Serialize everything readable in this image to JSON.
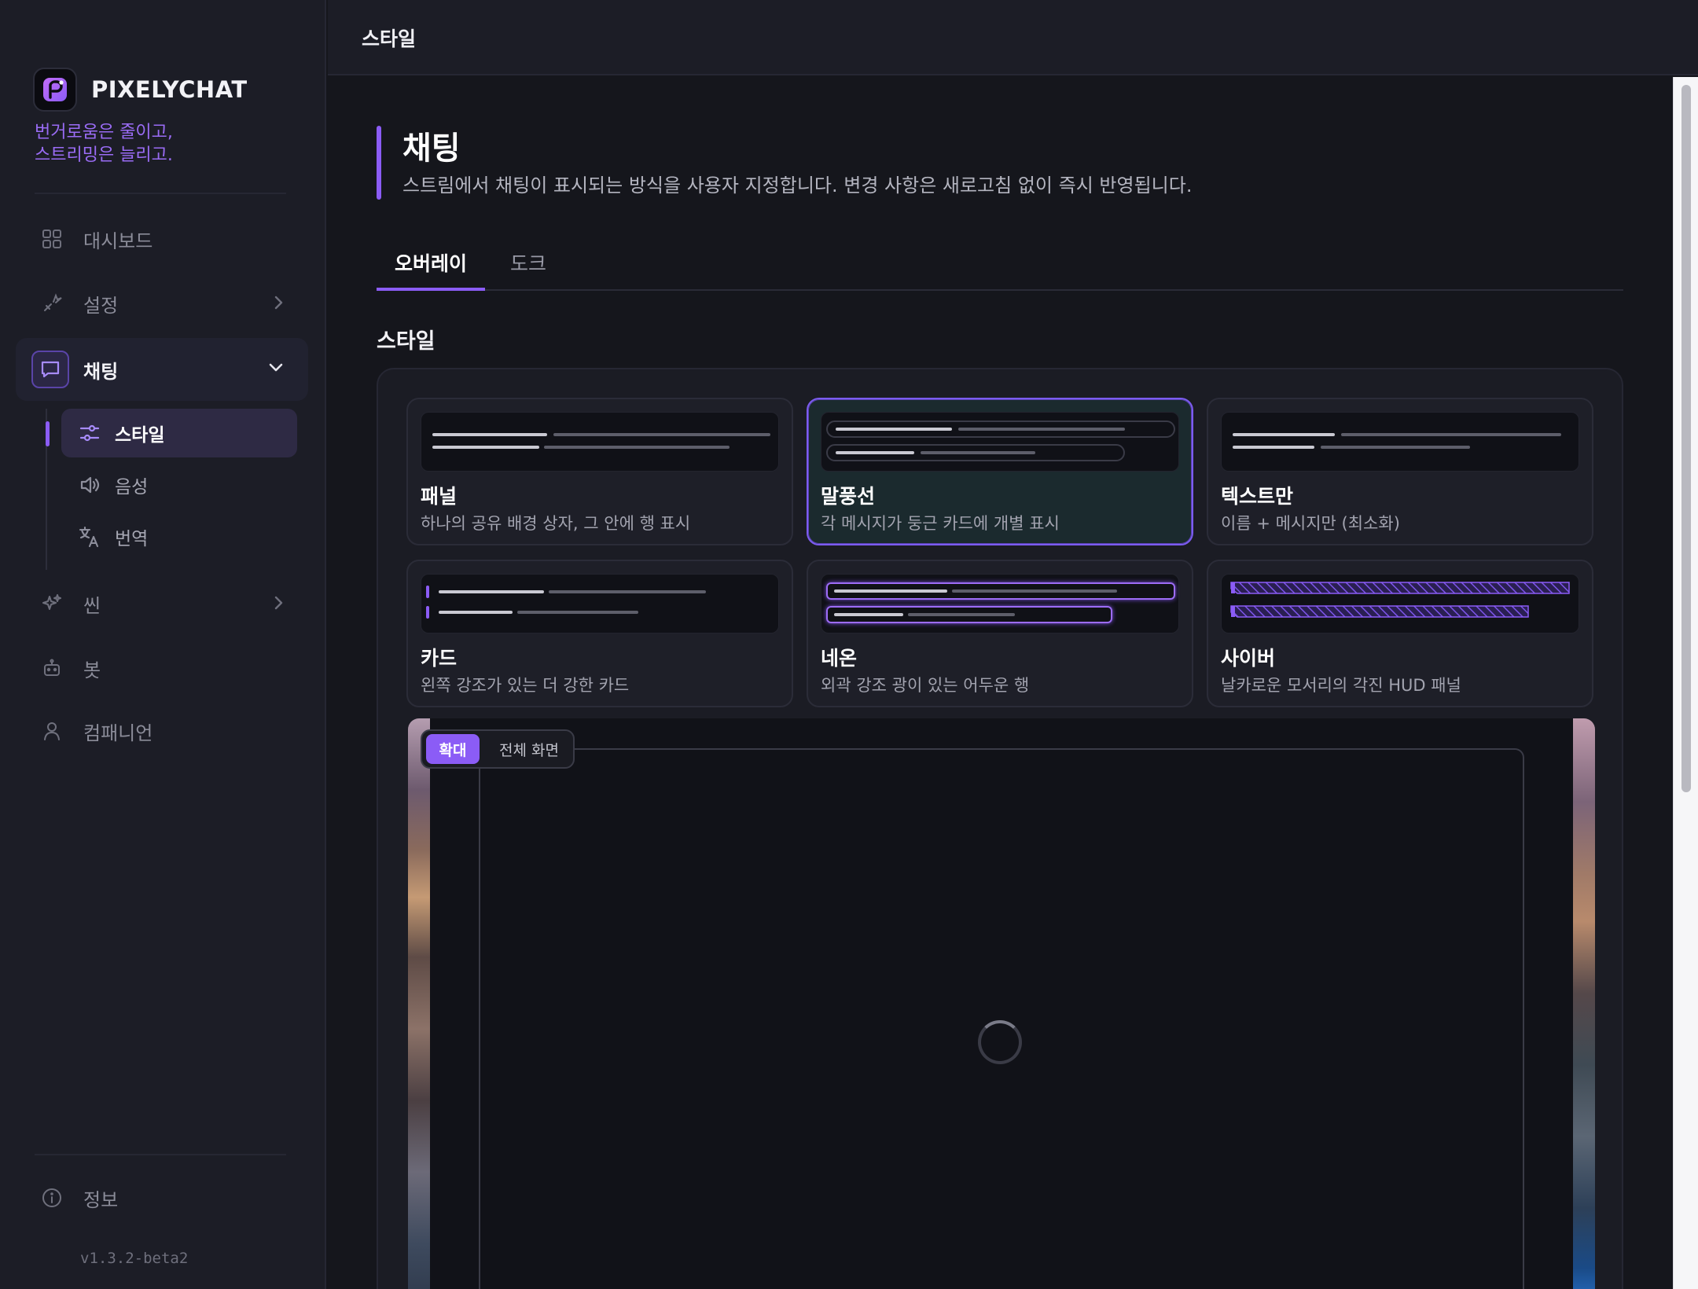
{
  "app": {
    "name": "PIXELYCHAT",
    "tagline_line1": "번거로움은 줄이고,",
    "tagline_line2": "스트리밍은 늘리고.",
    "version": "v1.3.2-beta2"
  },
  "colors": {
    "accent": "#8b5cf6",
    "background": "#15161c",
    "sidebar": "#1c1d26",
    "selected_card_bg": "#1b2a2e"
  },
  "sidebar": {
    "items": [
      {
        "label": "대시보드",
        "icon": "grid-icon"
      },
      {
        "label": "설정",
        "icon": "wrench-icon"
      },
      {
        "label": "채팅",
        "icon": "chat-bubble-icon"
      },
      {
        "label": "씬",
        "icon": "sparkles-icon"
      },
      {
        "label": "봇",
        "icon": "robot-icon"
      },
      {
        "label": "컴패니언",
        "icon": "person-icon"
      }
    ],
    "subitems": [
      {
        "label": "스타일",
        "icon": "sliders-icon"
      },
      {
        "label": "음성",
        "icon": "speaker-icon"
      },
      {
        "label": "번역",
        "icon": "translate-icon"
      }
    ],
    "footer_item": {
      "label": "정보",
      "icon": "info-icon"
    }
  },
  "topbar": {
    "title": "스타일"
  },
  "page": {
    "title": "채팅",
    "description": "스트림에서 채팅이 표시되는 방식을 사용자 지정합니다. 변경 사항은 새로고침 없이 즉시 반영됩니다."
  },
  "tabs": [
    {
      "label": "오버레이"
    },
    {
      "label": "도크"
    }
  ],
  "section": {
    "title": "스타일"
  },
  "styles": [
    {
      "title": "패널",
      "desc": "하나의 공유 배경 상자, 그 안에 행 표시"
    },
    {
      "title": "말풍선",
      "desc": "각 메시지가 둥근 카드에 개별 표시"
    },
    {
      "title": "텍스트만",
      "desc": "이름 + 메시지만 (최소화)"
    },
    {
      "title": "카드",
      "desc": "왼쪽 강조가 있는 더 강한 카드"
    },
    {
      "title": "네온",
      "desc": "외곽 강조 광이 있는 어두운 행"
    },
    {
      "title": "사이버",
      "desc": "날카로운 모서리의 각진 HUD 패널"
    }
  ],
  "preview": {
    "zoom_label": "확대",
    "fullscreen_label": "전체 화면"
  }
}
